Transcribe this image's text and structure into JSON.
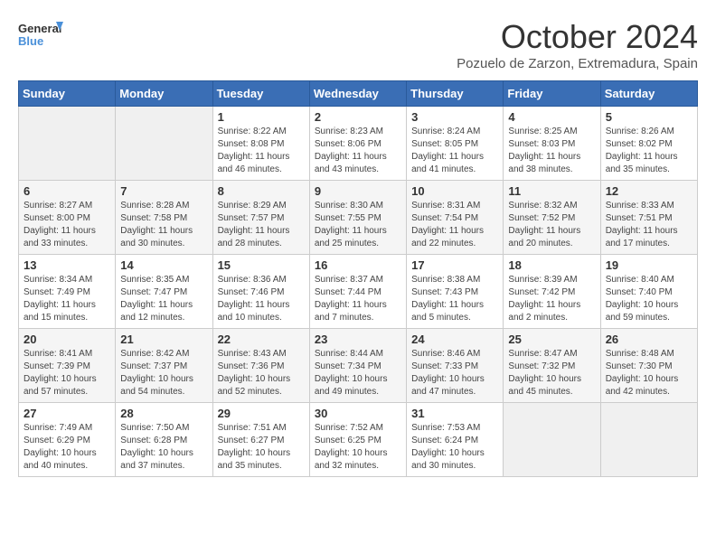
{
  "logo": {
    "line1": "General",
    "line2": "Blue"
  },
  "title": "October 2024",
  "subtitle": "Pozuelo de Zarzon, Extremadura, Spain",
  "days_of_week": [
    "Sunday",
    "Monday",
    "Tuesday",
    "Wednesday",
    "Thursday",
    "Friday",
    "Saturday"
  ],
  "weeks": [
    [
      {
        "num": "",
        "info": ""
      },
      {
        "num": "",
        "info": ""
      },
      {
        "num": "1",
        "info": "Sunrise: 8:22 AM\nSunset: 8:08 PM\nDaylight: 11 hours and 46 minutes."
      },
      {
        "num": "2",
        "info": "Sunrise: 8:23 AM\nSunset: 8:06 PM\nDaylight: 11 hours and 43 minutes."
      },
      {
        "num": "3",
        "info": "Sunrise: 8:24 AM\nSunset: 8:05 PM\nDaylight: 11 hours and 41 minutes."
      },
      {
        "num": "4",
        "info": "Sunrise: 8:25 AM\nSunset: 8:03 PM\nDaylight: 11 hours and 38 minutes."
      },
      {
        "num": "5",
        "info": "Sunrise: 8:26 AM\nSunset: 8:02 PM\nDaylight: 11 hours and 35 minutes."
      }
    ],
    [
      {
        "num": "6",
        "info": "Sunrise: 8:27 AM\nSunset: 8:00 PM\nDaylight: 11 hours and 33 minutes."
      },
      {
        "num": "7",
        "info": "Sunrise: 8:28 AM\nSunset: 7:58 PM\nDaylight: 11 hours and 30 minutes."
      },
      {
        "num": "8",
        "info": "Sunrise: 8:29 AM\nSunset: 7:57 PM\nDaylight: 11 hours and 28 minutes."
      },
      {
        "num": "9",
        "info": "Sunrise: 8:30 AM\nSunset: 7:55 PM\nDaylight: 11 hours and 25 minutes."
      },
      {
        "num": "10",
        "info": "Sunrise: 8:31 AM\nSunset: 7:54 PM\nDaylight: 11 hours and 22 minutes."
      },
      {
        "num": "11",
        "info": "Sunrise: 8:32 AM\nSunset: 7:52 PM\nDaylight: 11 hours and 20 minutes."
      },
      {
        "num": "12",
        "info": "Sunrise: 8:33 AM\nSunset: 7:51 PM\nDaylight: 11 hours and 17 minutes."
      }
    ],
    [
      {
        "num": "13",
        "info": "Sunrise: 8:34 AM\nSunset: 7:49 PM\nDaylight: 11 hours and 15 minutes."
      },
      {
        "num": "14",
        "info": "Sunrise: 8:35 AM\nSunset: 7:47 PM\nDaylight: 11 hours and 12 minutes."
      },
      {
        "num": "15",
        "info": "Sunrise: 8:36 AM\nSunset: 7:46 PM\nDaylight: 11 hours and 10 minutes."
      },
      {
        "num": "16",
        "info": "Sunrise: 8:37 AM\nSunset: 7:44 PM\nDaylight: 11 hours and 7 minutes."
      },
      {
        "num": "17",
        "info": "Sunrise: 8:38 AM\nSunset: 7:43 PM\nDaylight: 11 hours and 5 minutes."
      },
      {
        "num": "18",
        "info": "Sunrise: 8:39 AM\nSunset: 7:42 PM\nDaylight: 11 hours and 2 minutes."
      },
      {
        "num": "19",
        "info": "Sunrise: 8:40 AM\nSunset: 7:40 PM\nDaylight: 10 hours and 59 minutes."
      }
    ],
    [
      {
        "num": "20",
        "info": "Sunrise: 8:41 AM\nSunset: 7:39 PM\nDaylight: 10 hours and 57 minutes."
      },
      {
        "num": "21",
        "info": "Sunrise: 8:42 AM\nSunset: 7:37 PM\nDaylight: 10 hours and 54 minutes."
      },
      {
        "num": "22",
        "info": "Sunrise: 8:43 AM\nSunset: 7:36 PM\nDaylight: 10 hours and 52 minutes."
      },
      {
        "num": "23",
        "info": "Sunrise: 8:44 AM\nSunset: 7:34 PM\nDaylight: 10 hours and 49 minutes."
      },
      {
        "num": "24",
        "info": "Sunrise: 8:46 AM\nSunset: 7:33 PM\nDaylight: 10 hours and 47 minutes."
      },
      {
        "num": "25",
        "info": "Sunrise: 8:47 AM\nSunset: 7:32 PM\nDaylight: 10 hours and 45 minutes."
      },
      {
        "num": "26",
        "info": "Sunrise: 8:48 AM\nSunset: 7:30 PM\nDaylight: 10 hours and 42 minutes."
      }
    ],
    [
      {
        "num": "27",
        "info": "Sunrise: 7:49 AM\nSunset: 6:29 PM\nDaylight: 10 hours and 40 minutes."
      },
      {
        "num": "28",
        "info": "Sunrise: 7:50 AM\nSunset: 6:28 PM\nDaylight: 10 hours and 37 minutes."
      },
      {
        "num": "29",
        "info": "Sunrise: 7:51 AM\nSunset: 6:27 PM\nDaylight: 10 hours and 35 minutes."
      },
      {
        "num": "30",
        "info": "Sunrise: 7:52 AM\nSunset: 6:25 PM\nDaylight: 10 hours and 32 minutes."
      },
      {
        "num": "31",
        "info": "Sunrise: 7:53 AM\nSunset: 6:24 PM\nDaylight: 10 hours and 30 minutes."
      },
      {
        "num": "",
        "info": ""
      },
      {
        "num": "",
        "info": ""
      }
    ]
  ]
}
